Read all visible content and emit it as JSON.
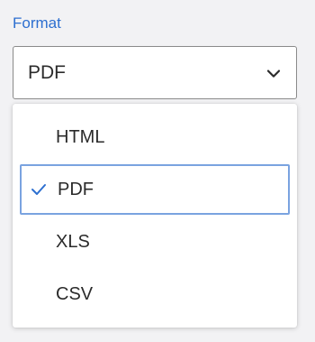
{
  "format": {
    "label": "Format",
    "selected_value": "PDF",
    "options": [
      {
        "label": "HTML",
        "selected": false
      },
      {
        "label": "PDF",
        "selected": true
      },
      {
        "label": "XLS",
        "selected": false
      },
      {
        "label": "CSV",
        "selected": false
      }
    ]
  },
  "icons": {
    "dropdown": "chevron-down-icon",
    "selected_marker": "checkmark-icon"
  },
  "colors": {
    "label": "#2d6fd0",
    "focus_border": "#7aa3e0",
    "check": "#2d6fd0"
  }
}
